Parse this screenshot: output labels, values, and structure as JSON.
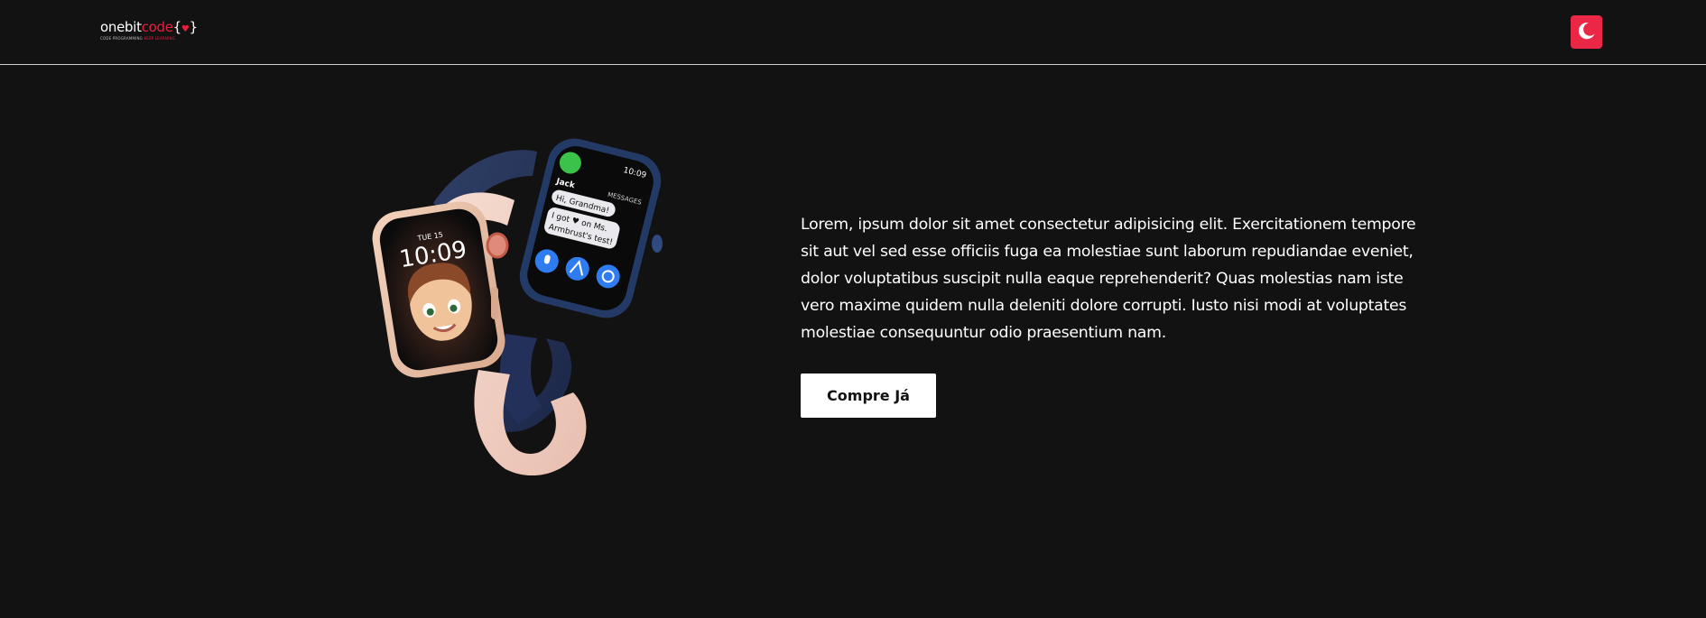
{
  "header": {
    "logo": {
      "word1": "onebit",
      "word2": "code",
      "brace_open": "{",
      "heart": "♥",
      "brace_close": "}",
      "tagline_part1": "CODE PROGRAMMING ",
      "tagline_part2": "KEEP LEARNING"
    },
    "theme_toggle": {
      "icon": "moon-icon",
      "color": "#ea2746"
    }
  },
  "hero": {
    "product_image": {
      "watch1": {
        "complication": "TUE 15",
        "time": "10:09",
        "case_color": "#e9c2a6",
        "band_color": "#f1d2c6"
      },
      "watch2": {
        "time": "10:09",
        "contact": "Jack",
        "app_label": "MESSAGES",
        "bubble1": "Hi, Grandma!",
        "bubble2_line1": "I got ♥ on Ms.",
        "bubble2_line2": "Armbrust's test!",
        "case_color": "#2b3a5e",
        "band_color": "#243459"
      }
    },
    "description": "Lorem, ipsum dolor sit amet consectetur adipisicing elit. Exercitationem tempore sit aut vel sed esse officiis fuga ea molestiae sunt laborum repudiandae eveniet, dolor voluptatibus suscipit nulla eaque reprehenderit? Quas molestias nam iste vero maxime quidem nulla deleniti dolore corrupti. Iusto nisi modi at voluptates molestiae consequuntur odio praesentium nam.",
    "cta_label": "Compre Já"
  },
  "colors": {
    "background": "#121212",
    "accent": "#ea2746",
    "text": "#ffffff"
  }
}
